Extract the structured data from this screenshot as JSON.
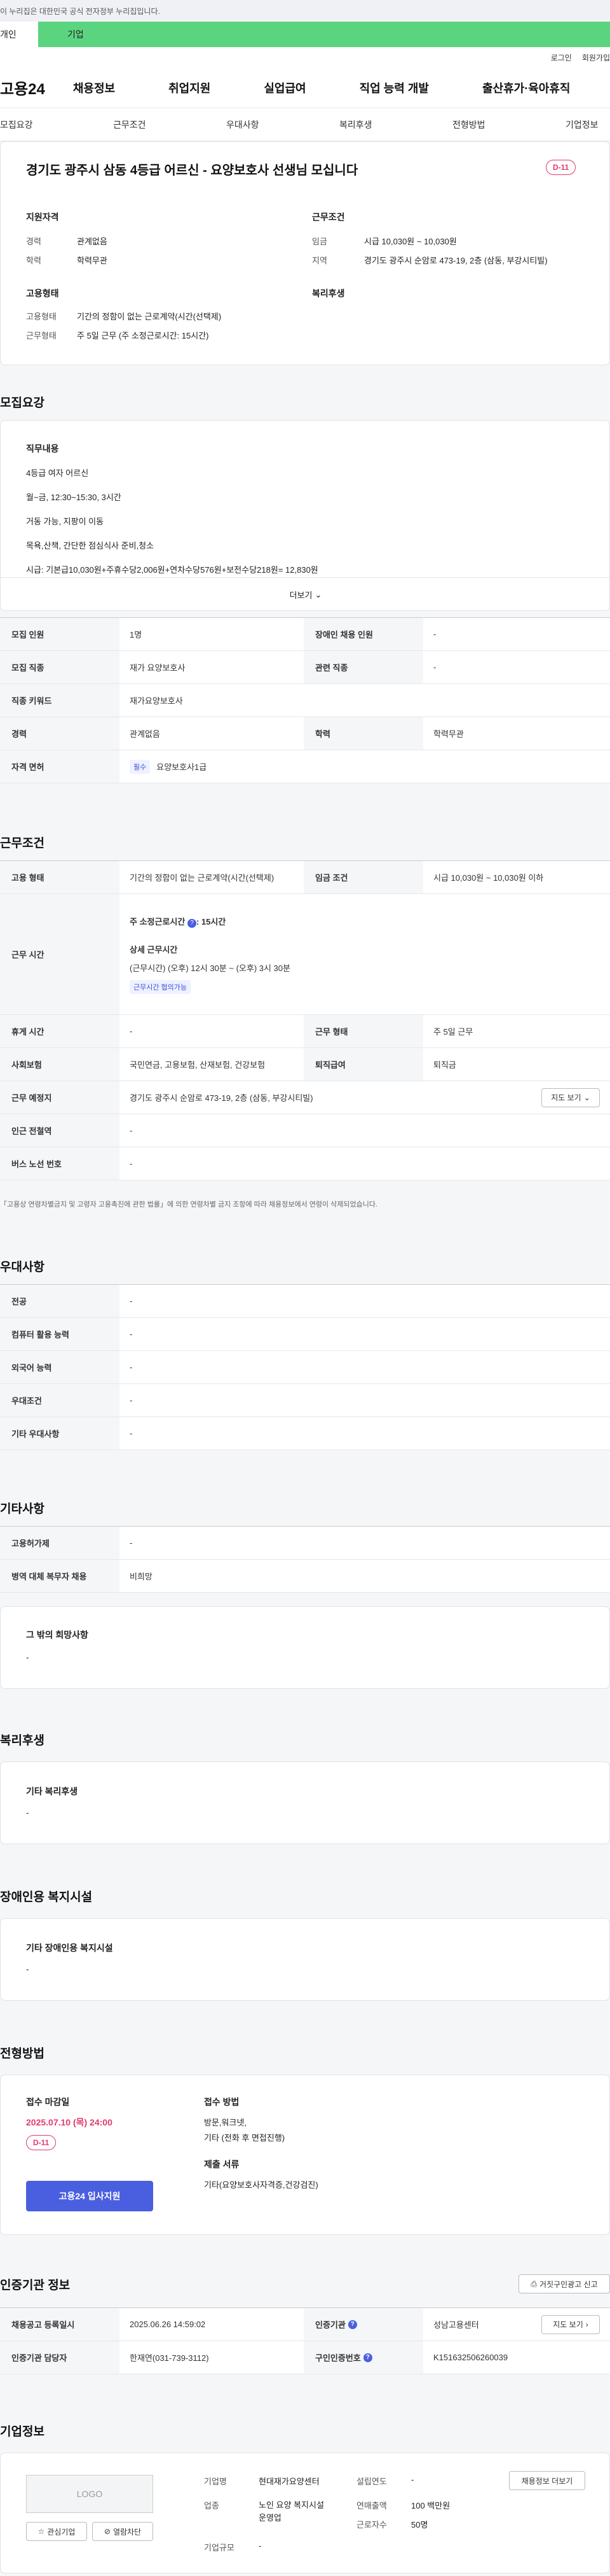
{
  "notice": "이 누리집은 대한민국 공식 전자정부 누리집입니다.",
  "type_tabs": [
    "개인",
    "기업"
  ],
  "util": [
    "로그인",
    "회원가입"
  ],
  "gnb": {
    "logo": "고용24",
    "menus": [
      "채용정보",
      "취업지원",
      "실업급여",
      "직업 능력 개발",
      "출산휴가·육아휴직"
    ]
  },
  "subnav": [
    "모집요강",
    "근무조건",
    "우대사항",
    "복리후생",
    "전형방법",
    "기업정보"
  ],
  "job": {
    "title": "경기도 광주시 삼동 4등급 어르신 - 요양보호사 선생님 모십니다",
    "dday": "D-11",
    "qual_title": "지원자격",
    "career_label": "경력",
    "career": "관계없음",
    "edu_label": "학력",
    "edu": "학력무관",
    "emp_title": "고용형태",
    "emp_label": "고용형태",
    "emp": "기간의 정함이 없는 근로계약(시간(선택제)",
    "work_label": "근무형태",
    "work": "주 5일 근무 (주 소정근로시간: 15시간)",
    "cond_title": "근무조건",
    "wage_label": "임금",
    "wage": "시급 10,030원 ~ 10,030원",
    "region_label": "지역",
    "region": "경기도 광주시 순암로 473-19, 2층 (삼동, 부강시티빌)",
    "welfare_title": "복리후생"
  },
  "recruit": {
    "title": "모집요강",
    "duty_title": "직무내용",
    "lines": [
      "4등급 여자 어르신",
      "월~금, 12:30~15:30, 3시간",
      "거동 가능, 지팡이 이동",
      "목욕,산책, 간단한 점심식사 준비,청소",
      "시급: 기본급10,030원+주휴수당2,006원+연차수당576원+보전수당218원= 12,830원"
    ],
    "more": "더보기",
    "rows": [
      [
        "모집 인원",
        "1명",
        "장애인 채용 인원",
        "-"
      ],
      [
        "모집 직종",
        "재가 요양보호사",
        "관련 직종",
        "-"
      ],
      [
        "직종 키워드",
        "재가요양보호사"
      ],
      [
        "경력",
        "관계없음",
        "학력",
        "학력무관"
      ]
    ],
    "license_label": "자격 면허",
    "license_chip": "필수",
    "license": "요양보호사1급"
  },
  "work": {
    "title": "근무조건",
    "emp_label": "고용 형태",
    "emp": "기간의 정함이 없는 근로계약(시간(선택제)",
    "wage_label": "임금 조건",
    "wage": "시급 10,030원 ~ 10,030원 이하",
    "time_label": "근무 시간",
    "weekly": "주 소정근로시간",
    "weekly_val": ": 15시간",
    "detail_title": "상세 근무시간",
    "detail": "(근무시간) (오후) 12시 30분 ~ (오후) 3시 30분",
    "chip": "근무시간 협의가능",
    "rest_label": "휴게 시간",
    "rest": "-",
    "type_label": "근무 형태",
    "type": "주 5일 근무",
    "ins_label": "사회보험",
    "ins": "국민연금, 고용보험, 산재보험, 건강보험",
    "ret_label": "퇴직급여",
    "ret": "퇴직금",
    "addr_label": "근무 예정지",
    "addr": "경기도 광주시 순암로 473-19, 2층 (삼동, 부강시티빌)",
    "map_btn": "지도 보기",
    "subway_label": "인근 전철역",
    "subway": "-",
    "bus_label": "버스 노선 번호",
    "bus": "-",
    "note": "「고용상 연령차별금지 및 고령자 고용촉진에 관한 법률」에 의한 연령차별 금지 조항에 따라 채용정보에서 연령이 삭제되었습니다."
  },
  "pref": {
    "title": "우대사항",
    "rows": [
      [
        "전공",
        "-"
      ],
      [
        "컴퓨터 활용 능력",
        "-"
      ],
      [
        "외국어 능력",
        "-"
      ],
      [
        "우대조건",
        "-"
      ],
      [
        "기타 우대사항",
        "-"
      ]
    ]
  },
  "etc": {
    "title": "기타사항",
    "rows": [
      [
        "고용허가제",
        "-"
      ],
      [
        "병역 대체 복무자 채용",
        "비희망"
      ]
    ],
    "box_title": "그 밖의 희망사항",
    "box_val": "-"
  },
  "welfare": {
    "title": "복리후생",
    "box_title": "기타 복리후생",
    "box_val": "-"
  },
  "disabled": {
    "title": "장애인용 복지시설",
    "box_title": "기타 장애인용 복지시설",
    "box_val": "-"
  },
  "process": {
    "title": "전형방법",
    "deadline_label": "접수 마감일",
    "deadline": "2025.07.10 (목) 24:00",
    "dday": "D-11",
    "apply": "고용24 입사지원",
    "method_label": "접수 방법",
    "method": "방문,워크넷,",
    "method2": "기타 (전화 후 면접진행)",
    "docs_label": "제출 서류",
    "docs": "기타(요양보호사자격증,건강검진)"
  },
  "agency": {
    "title": "인증기관 정보",
    "report": "거짓구인광고 신고",
    "reg_label": "채용공고 등록일시",
    "reg": "2025.06.26 14:59:02",
    "org_label": "인증기관",
    "org": "성남고용센터",
    "map": "지도 보기",
    "mgr_label": "인증기관 담당자",
    "mgr": "한재연(031-739-3112)",
    "no_label": "구인인증번호",
    "no": "K151632506260039"
  },
  "company": {
    "title": "기업정보",
    "logo": "LOGO",
    "fav": "관심기업",
    "block": "열람차단",
    "name_label": "기업명",
    "name": "현대재가요양센터",
    "found_label": "설립연도",
    "found": "-",
    "ind_label": "업종",
    "ind": "노인 요양 복지시설 운영업",
    "sales_label": "연매출액",
    "sales": "100 백만원",
    "emp_label": "근로자수",
    "emp": "50명",
    "size_label": "기업규모",
    "size": "-",
    "jobs_btn": "채용정보 더보기"
  },
  "colors": {
    "accent": "#4a5fe0",
    "green": "#5bd47f",
    "dday": "#e23a6c"
  }
}
